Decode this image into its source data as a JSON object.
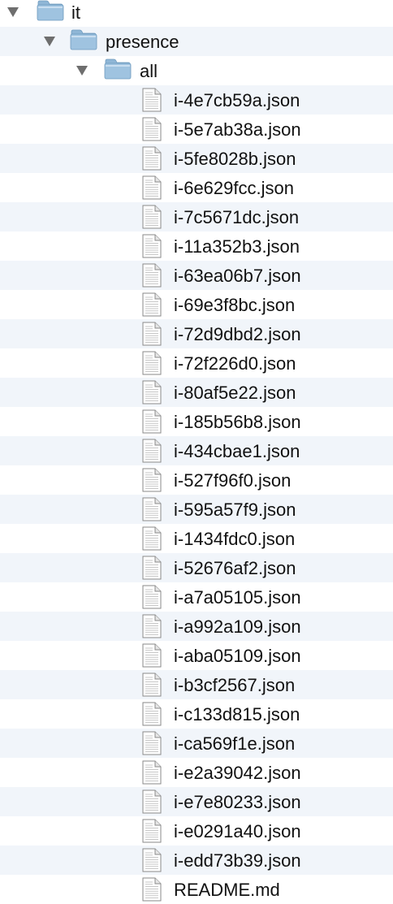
{
  "tree": {
    "folders": [
      {
        "name": "it",
        "expanded": true,
        "icon": "folder-icon"
      },
      {
        "name": "presence",
        "expanded": true,
        "icon": "folder-icon"
      },
      {
        "name": "all",
        "expanded": true,
        "icon": "folder-icon"
      }
    ],
    "files": [
      "i-4e7cb59a.json",
      "i-5e7ab38a.json",
      "i-5fe8028b.json",
      "i-6e629fcc.json",
      "i-7c5671dc.json",
      "i-11a352b3.json",
      "i-63ea06b7.json",
      "i-69e3f8bc.json",
      "i-72d9dbd2.json",
      "i-72f226d0.json",
      "i-80af5e22.json",
      "i-185b56b8.json",
      "i-434cbae1.json",
      "i-527f96f0.json",
      "i-595a57f9.json",
      "i-1434fdc0.json",
      "i-52676af2.json",
      "i-a7a05105.json",
      "i-a992a109.json",
      "i-aba05109.json",
      "i-b3cf2567.json",
      "i-c133d815.json",
      "i-ca569f1e.json",
      "i-e2a39042.json",
      "i-e7e80233.json",
      "i-e0291a40.json",
      "i-edd73b39.json",
      "README.md"
    ]
  },
  "colors": {
    "stripe": "#f1f5fa",
    "folder": "#9fc3e0",
    "disclosure": "#6e6e6e"
  },
  "icons": {
    "folder": "folder-icon",
    "file": "document-icon",
    "disclosure": "disclosure-triangle-icon"
  }
}
